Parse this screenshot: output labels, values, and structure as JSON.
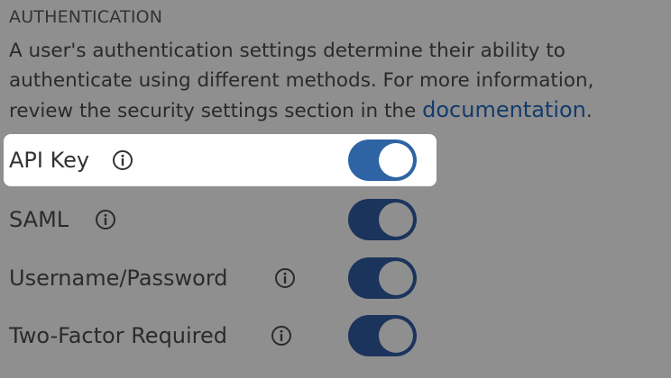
{
  "section": {
    "heading": "AUTHENTICATION",
    "description_before_link": "A user's authentication settings determine their ability to authenticate using different methods. For more information, review the security settings section in the ",
    "link_text": "documentation",
    "description_after_link": "."
  },
  "settings": [
    {
      "label": "API Key",
      "enabled": true,
      "highlighted": true
    },
    {
      "label": "SAML",
      "enabled": true,
      "highlighted": false
    },
    {
      "label": "Username/Password",
      "enabled": true,
      "highlighted": false
    },
    {
      "label": "Two-Factor Required",
      "enabled": true,
      "highlighted": false
    }
  ],
  "colors": {
    "overlay_background": "#8f8f8f",
    "toggle_on_highlighted": "#2e64a3",
    "toggle_on_dimmed": "#1b345c",
    "link": "#133b6b"
  },
  "icons": {
    "info": "info-circle-icon"
  }
}
